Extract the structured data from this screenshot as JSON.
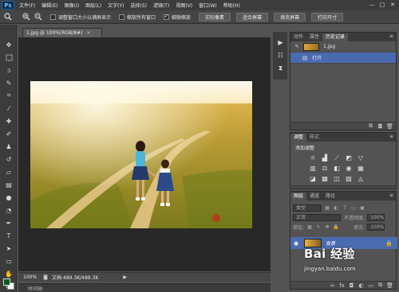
{
  "app": {
    "logo": "Ps",
    "menu": [
      "文件(F)",
      "编辑(E)",
      "图像(I)",
      "图层(L)",
      "文字(Y)",
      "选择(S)",
      "滤镜(T)",
      "视图(V)",
      "窗口(W)",
      "帮助(H)"
    ],
    "window_controls": [
      "—",
      "□",
      "✕"
    ]
  },
  "options_bar": {
    "tool_icon": "zoom-icon",
    "zoom_in_icon": "zoom-in-icon",
    "zoom_out_icon": "zoom-out-icon",
    "resize_windows_label": "调整窗口大小以满屏显示",
    "resize_windows_checked": false,
    "zoom_all_label": "缩放所有窗口",
    "zoom_all_checked": false,
    "scrubby_zoom_label": "细微缩放",
    "scrubby_zoom_checked": true,
    "actual_pixels_label": "实际像素",
    "fit_screen_label": "适合屏幕",
    "fill_screen_label": "填充屏幕",
    "print_size_label": "打印尺寸"
  },
  "document": {
    "tab_title": "1.jpg @ 100%(RGB/8#)",
    "close_glyph": "×",
    "zoom": "100%",
    "doc_info": "文档:489.3K/489.3K",
    "status_arrow": "▶",
    "timeline_label": "时间轴"
  },
  "history_panel": {
    "tabs": [
      "动作",
      "属性",
      "历史记录"
    ],
    "active_tab": 2,
    "snapshot_name": "1.jpg",
    "step_name": "打开",
    "menu_glyph": "≡",
    "footer_icons": [
      "new-document-from-state-icon",
      "snapshot-camera-icon",
      "trash-icon"
    ]
  },
  "adjustments_panel": {
    "tabs": [
      "调整",
      "样式"
    ],
    "active_tab": 0,
    "title": "添加调整",
    "icons": [
      "brightness-contrast-icon",
      "levels-icon",
      "curves-icon",
      "exposure-icon",
      "gradient-triangle-icon",
      "vibrance-icon",
      "hue-saturation-icon",
      "color-balance-icon",
      "black-white-icon",
      "photo-filter-icon",
      "channel-mixer-icon",
      "color-lookup-icon",
      "invert-icon",
      "posterize-icon",
      "threshold-icon",
      "selective-color-icon",
      "gradient-map-icon"
    ],
    "menu_glyph": "≡"
  },
  "layers_panel": {
    "tabs": [
      "图层",
      "通道",
      "路径"
    ],
    "active_tab": 0,
    "kind_label": "类型",
    "blend_mode": "正常",
    "opacity_label": "不透明度:",
    "opacity_value": "100%",
    "lock_label": "锁定:",
    "fill_label": "填充:",
    "fill_value": "100%",
    "layer_name": "背景",
    "menu_glyph": "≡"
  },
  "watermark": {
    "logo": "Bai 经验",
    "url": "jingyan.baidu.com"
  },
  "colors": {
    "foreground": "#0b5a1a",
    "background": "#ffffff",
    "selection": "#4a6bb0"
  }
}
